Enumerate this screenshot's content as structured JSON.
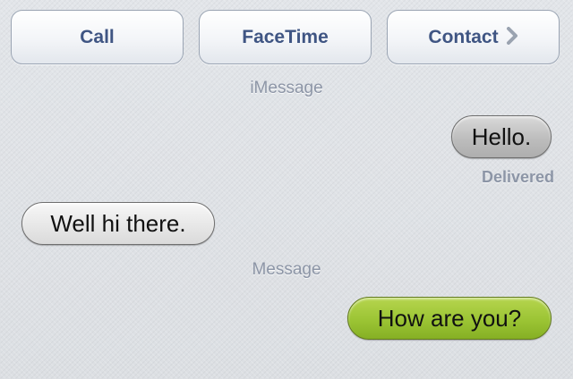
{
  "actions": {
    "call_label": "Call",
    "facetime_label": "FaceTime",
    "contact_label": "Contact"
  },
  "conversation": {
    "service_labels": [
      "iMessage",
      "Message"
    ],
    "messages": [
      {
        "direction": "outgoing",
        "service": "iMessage",
        "text": "Hello.",
        "status": "Delivered",
        "bubble_color": "#b8b8b8"
      },
      {
        "direction": "incoming",
        "text": "Well hi there.",
        "bubble_color": "#e6e6e6"
      },
      {
        "direction": "outgoing",
        "service": "Message",
        "text": "How are you?",
        "bubble_color": "#9bc434"
      }
    ]
  },
  "icons": {
    "contact_chevron": "chevron-right-icon"
  },
  "colors": {
    "button_text": "#3f5583",
    "label_text": "#8c95a6"
  }
}
